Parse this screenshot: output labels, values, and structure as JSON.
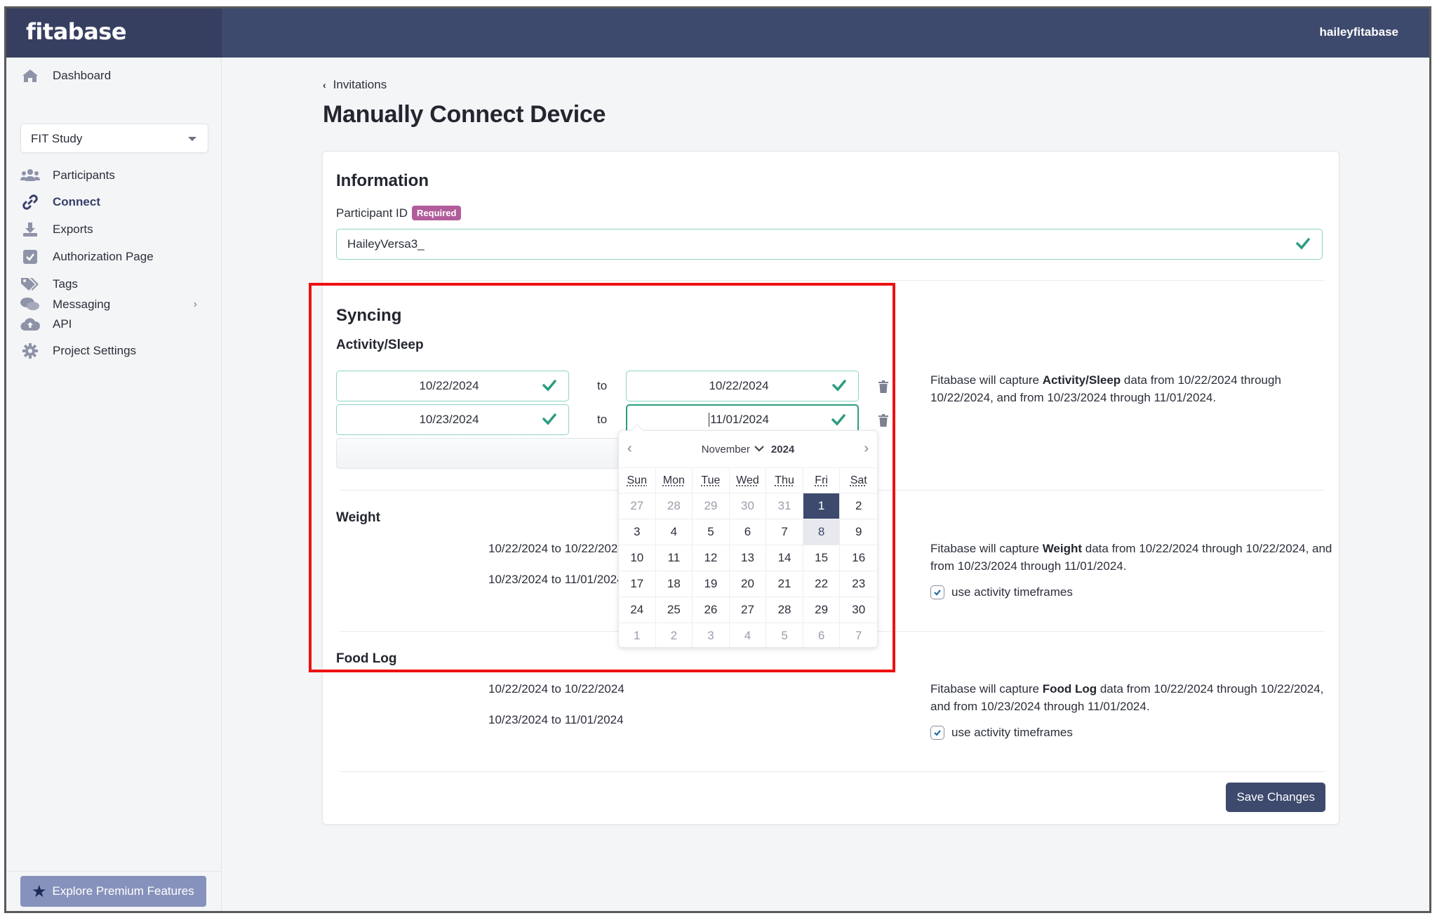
{
  "app": {
    "brand": "fitabase",
    "username": "haileyfitabase"
  },
  "sidebar": {
    "dashboard": "Dashboard",
    "study_select": "FIT Study",
    "items": [
      {
        "label": "Participants",
        "icon": "users-icon"
      },
      {
        "label": "Connect",
        "icon": "link-icon",
        "active": true
      },
      {
        "label": "Exports",
        "icon": "download-icon"
      },
      {
        "label": "Authorization Page",
        "icon": "checkbox-icon"
      },
      {
        "label": "Tags",
        "icon": "tags-icon"
      },
      {
        "label": "Messaging",
        "icon": "comments-icon",
        "has_submenu": true
      },
      {
        "label": "API",
        "icon": "cloud-upload-icon"
      },
      {
        "label": "Project Settings",
        "icon": "gear-icon"
      }
    ],
    "premium_button": "Explore Premium Features"
  },
  "breadcrumb": "Invitations",
  "page_title": "Manually Connect Device",
  "information": {
    "heading": "Information",
    "participant_id_label": "Participant ID",
    "required_badge": "Required",
    "participant_id_value": "HaileyVersa3_"
  },
  "syncing": {
    "heading": "Syncing",
    "activity": {
      "heading": "Activity/Sleep",
      "ranges": [
        {
          "start": "10/22/2024",
          "end": "10/22/2024"
        },
        {
          "start": "10/23/2024",
          "end": "11/01/2024"
        }
      ],
      "to_label": "to",
      "add_label": "+",
      "description_pre": "Fitabase will capture ",
      "description_bold": "Activity/Sleep",
      "description_post": " data from 10/22/2024 through 10/22/2024, and from 10/23/2024 through 11/01/2024."
    },
    "weight": {
      "heading": "Weight",
      "ranges": [
        "10/22/2024 to 10/22/2024",
        "10/23/2024 to 11/01/2024"
      ],
      "description_pre": "Fitabase will capture ",
      "description_bold": "Weight",
      "description_post": " data from 10/22/2024 through 10/22/2024, and from 10/23/2024 through 11/01/2024.",
      "checkbox_label": "use activity timeframes",
      "checked": true
    },
    "food_log": {
      "heading": "Food Log",
      "ranges": [
        "10/22/2024 to 10/22/2024",
        "10/23/2024 to 11/01/2024"
      ],
      "description_pre": "Fitabase will capture ",
      "description_bold": "Food Log",
      "description_post": " data from 10/22/2024 through 10/22/2024, and from 10/23/2024 through 11/01/2024.",
      "checkbox_label": "use activity timeframes",
      "checked": true
    }
  },
  "calendar": {
    "month": "November",
    "year": "2024",
    "weekdays": [
      "Sun",
      "Mon",
      "Tue",
      "Wed",
      "Thu",
      "Fri",
      "Sat"
    ],
    "days": [
      {
        "d": "27",
        "muted": true
      },
      {
        "d": "28",
        "muted": true
      },
      {
        "d": "29",
        "muted": true
      },
      {
        "d": "30",
        "muted": true
      },
      {
        "d": "31",
        "muted": true
      },
      {
        "d": "1",
        "selected": true
      },
      {
        "d": "2"
      },
      {
        "d": "3"
      },
      {
        "d": "4"
      },
      {
        "d": "5"
      },
      {
        "d": "6"
      },
      {
        "d": "7"
      },
      {
        "d": "8",
        "today": true
      },
      {
        "d": "9"
      },
      {
        "d": "10"
      },
      {
        "d": "11"
      },
      {
        "d": "12"
      },
      {
        "d": "13"
      },
      {
        "d": "14"
      },
      {
        "d": "15"
      },
      {
        "d": "16"
      },
      {
        "d": "17"
      },
      {
        "d": "18"
      },
      {
        "d": "19"
      },
      {
        "d": "20"
      },
      {
        "d": "21"
      },
      {
        "d": "22"
      },
      {
        "d": "23"
      },
      {
        "d": "24"
      },
      {
        "d": "25"
      },
      {
        "d": "26"
      },
      {
        "d": "27"
      },
      {
        "d": "28"
      },
      {
        "d": "29"
      },
      {
        "d": "30"
      },
      {
        "d": "1",
        "muted": true
      },
      {
        "d": "2",
        "muted": true
      },
      {
        "d": "3",
        "muted": true
      },
      {
        "d": "4",
        "muted": true
      },
      {
        "d": "5",
        "muted": true
      },
      {
        "d": "6",
        "muted": true
      },
      {
        "d": "7",
        "muted": true
      }
    ]
  },
  "save_button": "Save Changes",
  "colors": {
    "brand_navy": "#3d4a6d",
    "valid_green": "#2c9c82",
    "required_badge": "#b15d9b",
    "highlight_box": "#ee1111"
  }
}
